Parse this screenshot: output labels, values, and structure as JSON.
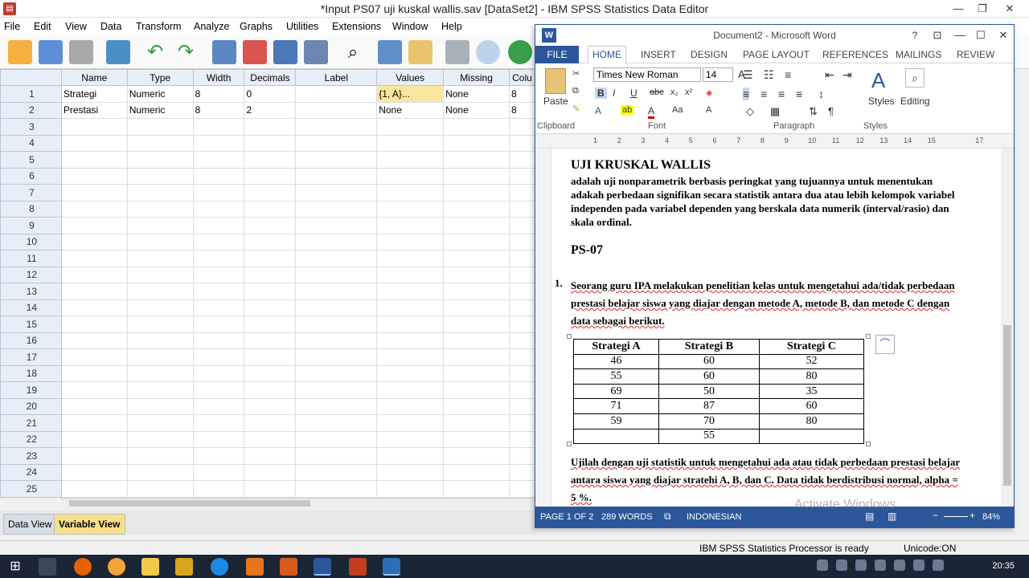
{
  "spss": {
    "title": "*Input PS07 uji kuskal wallis.sav [DataSet2] - IBM SPSS Statistics Data Editor",
    "menu": [
      "File",
      "Edit",
      "View",
      "Data",
      "Transform",
      "Analyze",
      "Graphs",
      "Utilities",
      "Extensions",
      "Window",
      "Help"
    ],
    "columns": [
      "Name",
      "Type",
      "Width",
      "Decimals",
      "Label",
      "Values",
      "Missing",
      "Colu"
    ],
    "rows": [
      {
        "num": "1",
        "name": "Strategi",
        "type": "Numeric",
        "width": "8",
        "decimals": "0",
        "label": "",
        "values": "{1, A}...",
        "missing": "None",
        "col": "8"
      },
      {
        "num": "2",
        "name": "Prestasi",
        "type": "Numeric",
        "width": "8",
        "decimals": "2",
        "label": "",
        "values": "None",
        "missing": "None",
        "col": "8"
      }
    ],
    "empty_row_numbers": [
      "3",
      "4",
      "5",
      "6",
      "7",
      "8",
      "9",
      "10",
      "11",
      "12",
      "13",
      "14",
      "15",
      "16",
      "17",
      "18",
      "19",
      "20",
      "21",
      "22",
      "23",
      "24",
      "25"
    ],
    "tabs": {
      "data_view": "Data View",
      "variable_view": "Variable View"
    },
    "status": {
      "processor": "IBM SPSS Statistics Processor is ready",
      "unicode": "Unicode:ON"
    }
  },
  "word": {
    "title": "Document2 - Microsoft Word",
    "tabs": [
      "FILE",
      "HOME",
      "INSERT",
      "DESIGN",
      "PAGE LAYOUT",
      "REFERENCES",
      "MAILINGS",
      "REVIEW"
    ],
    "ribbon": {
      "font_name": "Times New Roman",
      "font_size": "14",
      "paste_label": "Paste",
      "styles_label": "Styles",
      "editing_label": "Editing",
      "groups": [
        "Clipboard",
        "Font",
        "Paragraph",
        "Styles"
      ]
    },
    "ruler_ticks": [
      "1",
      "2",
      "3",
      "4",
      "5",
      "6",
      "7",
      "8",
      "9",
      "10",
      "11",
      "12",
      "13",
      "14",
      "15",
      "17"
    ],
    "doc": {
      "heading1": "UJI KRUSKAL WALLIS",
      "para1": "adalah uji nonparametrik berbasis peringkat yang tujuannya untuk menentukan adakah perbedaan signifikan secara statistik antara dua atau lebih kelompok variabel independen pada variabel dependen yang berskala data numerik (interval/rasio) dan skala ordinal.",
      "heading2": "PS-07",
      "item_number": "1.",
      "item_text": "Seorang guru IPA melakukan penelitian kelas untuk mengetahui ada/tidak perbedaan prestasi belajar siswa yang diajar dengan metode A, metode B, dan metode C dengan data sebagai berikut.",
      "table_headers": [
        "Strategi A",
        "Strategi B",
        "Strategi C"
      ],
      "table_rows": [
        [
          "46",
          "60",
          "52"
        ],
        [
          "55",
          "60",
          "80"
        ],
        [
          "69",
          "50",
          "35"
        ],
        [
          "71",
          "87",
          "60"
        ],
        [
          "59",
          "70",
          "80"
        ],
        [
          "",
          "55",
          ""
        ]
      ],
      "closing": "Ujilah dengan uji statistik untuk mengetahui ada atau tidak perbedaan prestasi belajar antara siswa yang diajar stratehi A, B, dan C. Data tidak berdistribusi normal, alpha = 5 %."
    },
    "status": {
      "page": "PAGE 1 OF 2",
      "words": "289 WORDS",
      "language": "INDONESIAN",
      "zoom": "84%"
    }
  },
  "watermark": "Activate Windows",
  "taskbar": {
    "clock": "20:35"
  }
}
